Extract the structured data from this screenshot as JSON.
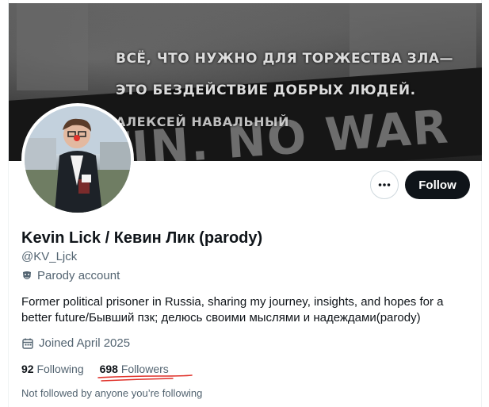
{
  "banner": {
    "quote_lines": [
      "ВСЁ, ЧТО НУЖНО ДЛЯ ТОРЖЕСТВА ЗЛА—",
      "ЭТО БЕЗДЕЙСТВИЕ ДОБРЫХ ЛЮДЕЙ."
    ],
    "quote_author": "АЛЕКСЕЙ НАВАЛЬНЫЙ",
    "sign_text": "PUTIN. NO WAR"
  },
  "actions": {
    "more_icon": "more-horizontal-icon",
    "follow_label": "Follow"
  },
  "profile": {
    "display_name": "Kevin Lick / Кевин Лик (parody)",
    "handle": "@KV_Ljck",
    "parody_icon": "theater-mask-icon",
    "parody_label": "Parody account",
    "bio": "Former political prisoner in Russia, sharing my journey, insights, and hopes for a better future/Бывший пзк; делюсь своими мыслями и надеждами(parody)",
    "joined_icon": "calendar-icon",
    "joined": "Joined April 2025"
  },
  "stats": {
    "following_count": "92",
    "following_label": "Following",
    "followers_count": "698",
    "followers_label": "Followers"
  },
  "footer": {
    "not_followed": "Not followed by anyone you’re following"
  },
  "colors": {
    "text_primary": "#0f1419",
    "text_secondary": "#536471",
    "follow_button": "#0f1419",
    "annotation_underline": "#e0322b"
  }
}
